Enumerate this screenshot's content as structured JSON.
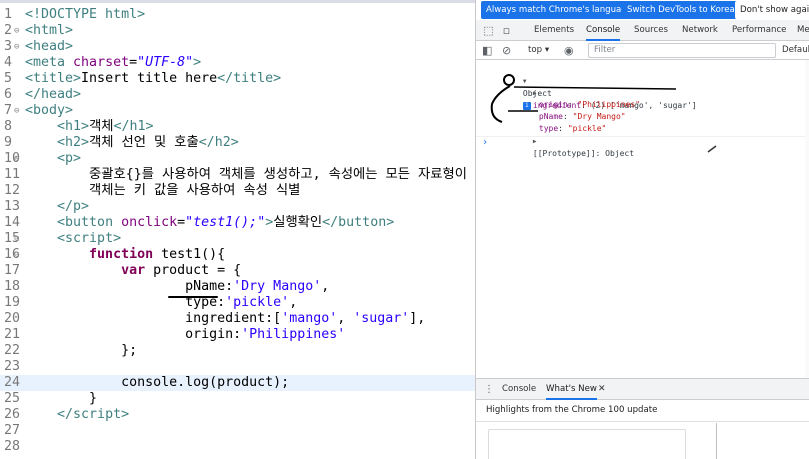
{
  "editor": {
    "lines": [
      {
        "n": "1",
        "html": "<span class='tag'>&lt;!DOCTYPE html&gt;</span>"
      },
      {
        "n": "2",
        "fold": "⊖",
        "html": "<span class='tag'>&lt;html&gt;</span>"
      },
      {
        "n": "3",
        "fold": "⊖",
        "html": "<span class='tag'>&lt;head&gt;</span>"
      },
      {
        "n": "4",
        "html": "<span class='tag'>&lt;meta </span><span class='attr'>charset</span><span class='txt'>=</span><span class='str'>\"UTF-8\"</span><span class='tag'>&gt;</span>"
      },
      {
        "n": "5",
        "html": "<span class='tag'>&lt;title&gt;</span><span class='txt'>Insert title here</span><span class='tag'>&lt;/title&gt;</span>"
      },
      {
        "n": "6",
        "html": "<span class='tag'>&lt;/head&gt;</span>"
      },
      {
        "n": "7",
        "fold": "⊖",
        "html": "<span class='tag'>&lt;body&gt;</span>"
      },
      {
        "n": "8",
        "html": "    <span class='tag'>&lt;h1&gt;</span><span class='txt'>객체</span><span class='tag'>&lt;/h1&gt;</span>"
      },
      {
        "n": "9",
        "html": "    <span class='tag'>&lt;h2&gt;</span><span class='txt'>객체 선언 및 호출</span><span class='tag'>&lt;/h2&gt;</span>"
      },
      {
        "n": "10",
        "fold": "⊖",
        "html": "    <span class='tag'>&lt;p&gt;</span>"
      },
      {
        "n": "11",
        "html": "        <span class='txt'>중괄호{}를 사용하여 객체를 생성하고, 속성에는 모든 자료형이 올 수 있음</span><span class='tag'>&lt;br</span>"
      },
      {
        "n": "12",
        "html": "        <span class='txt'>객체는 키 값을 사용하여 속성 식별</span>"
      },
      {
        "n": "13",
        "html": "    <span class='tag'>&lt;/p&gt;</span>"
      },
      {
        "n": "14",
        "html": "    <span class='tag'>&lt;button </span><span class='attr'>onclick</span><span class='txt'>=</span><span class='str'>\"test1();\"</span><span class='tag'>&gt;</span><span class='txt'>실행확인</span><span class='tag'>&lt;/button&gt;</span>"
      },
      {
        "n": "15",
        "fold": "⊖",
        "html": "    <span class='tag'>&lt;script&gt;</span>"
      },
      {
        "n": "16",
        "fold": "⊖",
        "html": "        <span class='kw'>function</span><span class='txt'> test1(){</span>"
      },
      {
        "n": "17",
        "html": "            <span class='kw'>var</span><span class='txt'> product = {</span>"
      },
      {
        "n": "18",
        "html": "                    <span class='txt'>pName:</span><span class='sq'>'Dry Mango'</span><span class='txt'>,</span>"
      },
      {
        "n": "19",
        "html": "                    <span class='txt'>type:</span><span class='sq'>'pickle'</span><span class='txt'>,</span>"
      },
      {
        "n": "20",
        "html": "                    <span class='txt'>ingredient:[</span><span class='sq'>'mango'</span><span class='txt'>, </span><span class='sq'>'sugar'</span><span class='txt'>],</span>"
      },
      {
        "n": "21",
        "html": "                    <span class='txt'>origin:</span><span class='sq'>'Philippines'</span>"
      },
      {
        "n": "22",
        "html": "            <span class='txt'>};</span>"
      },
      {
        "n": "23",
        "html": ""
      },
      {
        "n": "24",
        "current": true,
        "html": "            <span class='txt'>console.log(product);</span>"
      },
      {
        "n": "25",
        "html": "        <span class='txt'>}</span>"
      },
      {
        "n": "26",
        "html": "    <span class='tag'>&lt;/script&gt;</span>"
      },
      {
        "n": "27",
        "html": ""
      },
      {
        "n": "28",
        "html": ""
      }
    ]
  },
  "devtools": {
    "info_buttons": [
      "Always match Chrome's language",
      "Switch DevTools to Korean",
      "Don't show again"
    ],
    "tabs": [
      "Elements",
      "Console",
      "Sources",
      "Network",
      "Performance",
      "Me"
    ],
    "active_tab": "Console",
    "context": "top ▾",
    "filter_placeholder": "Filter",
    "levels": "Default",
    "console": {
      "object_label": "Object",
      "badge": "i",
      "ingredient_key": "ingredient",
      "ingredient_val": "(2) ['mango', 'sugar']",
      "origin_key": "origin",
      "origin_val": "\"Philippines\"",
      "pname_key": "pName",
      "pname_val": "\"Dry Mango\"",
      "type_key": "type",
      "type_val": "\"pickle\"",
      "proto": "[[Prototype]]: Object",
      "prompt": "›"
    },
    "drawer": {
      "tabs": [
        "Console",
        "What's New"
      ],
      "close": "✕",
      "highlights": "Highlights from the Chrome 100 update"
    }
  },
  "colors": {
    "accent": "#1a73e8",
    "key": "#881280",
    "string": "#c41a16"
  }
}
